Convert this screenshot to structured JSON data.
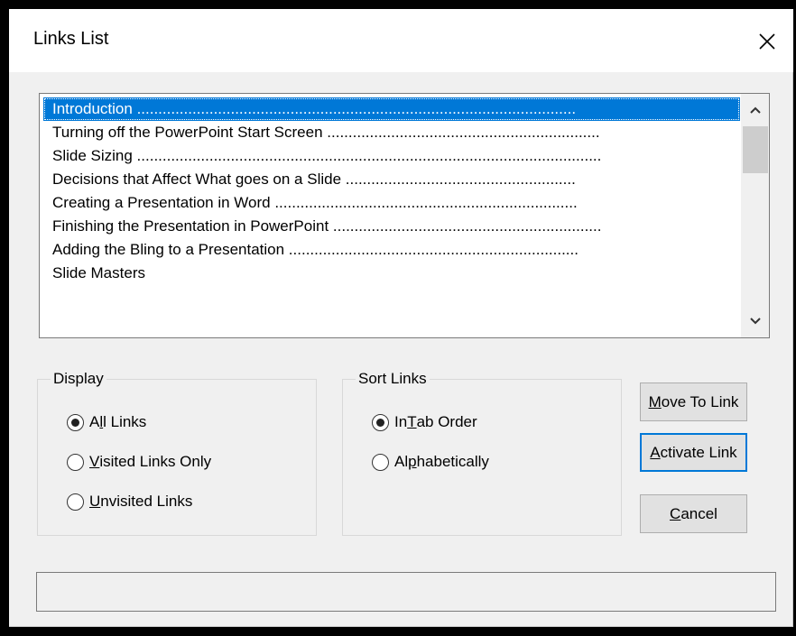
{
  "window": {
    "title": "Links List",
    "close_icon": "close-icon"
  },
  "list": {
    "items": [
      {
        "label": "Introduction",
        "dots": " .......................................................................................................",
        "selected": true
      },
      {
        "label": "Turning off the PowerPoint Start Screen",
        "dots": " ................................................................",
        "selected": false
      },
      {
        "label": "Slide Sizing",
        "dots": " .............................................................................................................",
        "selected": false
      },
      {
        "label": "Decisions that Affect What goes on a Slide",
        "dots": " ......................................................",
        "selected": false
      },
      {
        "label": "Creating a Presentation in Word",
        "dots": " .......................................................................",
        "selected": false
      },
      {
        "label": "Finishing the Presentation in PowerPoint",
        "dots": " ...............................................................",
        "selected": false
      },
      {
        "label": "Adding the Bling to a Presentation",
        "dots": " ....................................................................",
        "selected": false
      },
      {
        "label": "Slide Masters",
        "dots": "",
        "selected": false
      }
    ]
  },
  "display": {
    "legend": "Display",
    "options": [
      {
        "pre": "A",
        "key": "l",
        "post": "l Links",
        "checked": true
      },
      {
        "pre": "",
        "key": "V",
        "post": "isited Links Only",
        "checked": false
      },
      {
        "pre": "",
        "key": "U",
        "post": "nvisited Links",
        "checked": false
      }
    ]
  },
  "sort": {
    "legend": "Sort Links",
    "options": [
      {
        "pre": "In ",
        "key": "T",
        "post": "ab Order",
        "checked": true
      },
      {
        "pre": "Al",
        "key": "p",
        "post": "habetically",
        "checked": false
      }
    ]
  },
  "buttons": {
    "move": {
      "key": "M",
      "rest": "ove To Link"
    },
    "activate": {
      "key": "A",
      "rest": "ctivate Link"
    },
    "cancel": {
      "key": "C",
      "rest": "ancel"
    }
  },
  "status": {
    "text": ""
  },
  "colors": {
    "selection": "#0078d7",
    "dialog_bg": "#f0f0f0"
  }
}
